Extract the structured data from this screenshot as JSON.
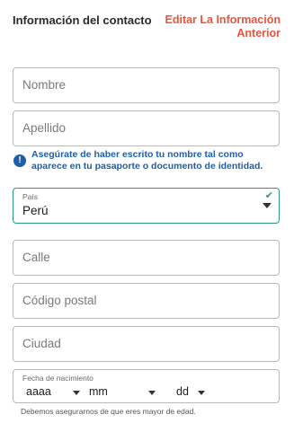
{
  "header": {
    "title": "Información del contacto",
    "edit_link": "Editar La Información Anterior"
  },
  "fields": {
    "first_name_placeholder": "Nombre",
    "last_name_placeholder": "Apellido",
    "street_placeholder": "Calle",
    "postal_code_placeholder": "Código postal",
    "city_placeholder": "Ciudad"
  },
  "info": {
    "icon": "info-icon",
    "text": "Asegúrate de haber escrito tu nombre tal como aparece en tu pasaporte o documento de identidad."
  },
  "country": {
    "label": "País",
    "value": "Perú",
    "status_icon": "check-icon"
  },
  "dob": {
    "label": "Fecha de nacimiento",
    "year": "aaaa",
    "month": "mm",
    "day": "dd"
  },
  "age_note": "Debemos asegurarnos de que eres mayor de edad.",
  "colors": {
    "accent_link": "#e8553e",
    "info_blue": "#1e5fa8",
    "valid_green": "#2e9a6b",
    "border": "#b9b9b9"
  }
}
